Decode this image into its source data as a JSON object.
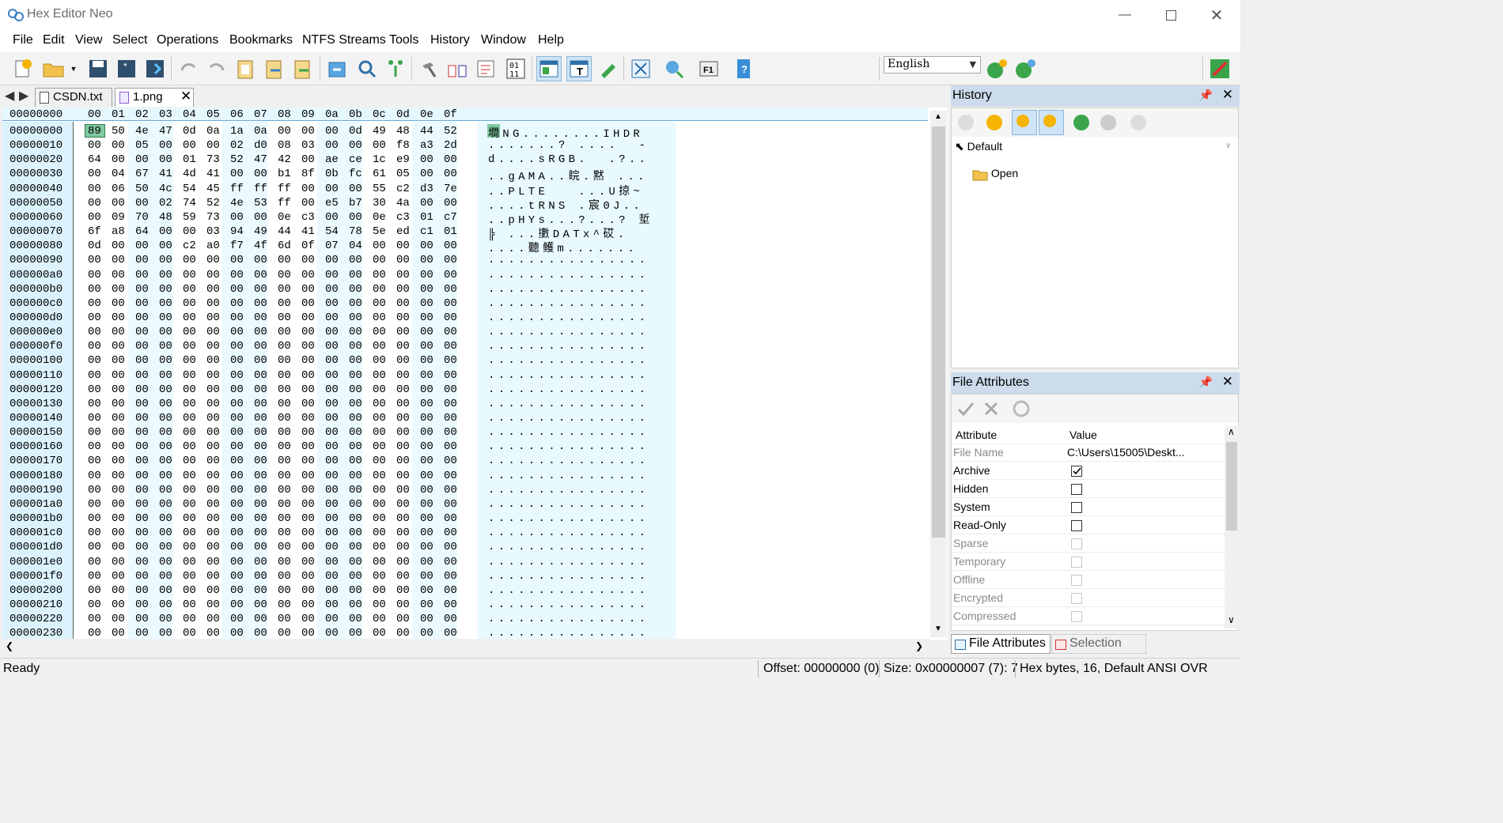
{
  "window": {
    "title": "Hex Editor Neo"
  },
  "menu": [
    "File",
    "Edit",
    "View",
    "Select",
    "Operations",
    "Bookmarks",
    "NTFS Streams",
    "Tools",
    "History",
    "Window",
    "Help"
  ],
  "toolbar": {
    "language": "English"
  },
  "tabs": [
    {
      "label": "CSDN.txt",
      "active": false
    },
    {
      "label": "1.png",
      "active": true
    }
  ],
  "hex": {
    "header_offset": "00000000",
    "columns": [
      "00",
      "01",
      "02",
      "03",
      "04",
      "05",
      "06",
      "07",
      "08",
      "09",
      "0a",
      "0b",
      "0c",
      "0d",
      "0e",
      "0f"
    ],
    "rows": [
      {
        "off": "00000000",
        "bytes": "89 50 4e 47 0d 0a 1a 0a 00 00 00 0d 49 48 44 52",
        "text": "墹NG........IHDR"
      },
      {
        "off": "00000010",
        "bytes": "00 00 05 00 00 00 02 d0 08 03 00 00 00 f8 a3 2d",
        "text": ".......? ....  -"
      },
      {
        "off": "00000020",
        "bytes": "64 00 00 00 01 73 52 47 42 00 ae ce 1c e9 00 00",
        "text": "d....sRGB.  .?.."
      },
      {
        "off": "00000030",
        "bytes": "00 04 67 41 4d 41 00 00 b1 8f 0b fc 61 05 00 00",
        "text": "..gAMA..睆.黙 ..."
      },
      {
        "off": "00000040",
        "bytes": "00 06 50 4c 54 45 ff ff ff 00 00 00 55 c2 d3 7e",
        "text": "..PLTE   ...U掠~"
      },
      {
        "off": "00000050",
        "bytes": "00 00 00 02 74 52 4e 53 ff 00 e5 b7 30 4a 00 00",
        "text": "....tRNS .宸0J.."
      },
      {
        "off": "00000060",
        "bytes": "00 09 70 48 59 73 00 00 0e c3 00 00 0e c3 01 c7",
        "text": "..pHYs...?...? 埑"
      },
      {
        "off": "00000070",
        "bytes": "6f a8 64 00 00 03 94 49 44 41 54 78 5e ed c1 01",
        "text": "╠ ...擻DATx^砹."
      },
      {
        "off": "00000080",
        "bytes": "0d 00 00 00 c2 a0 f7 4f 6d 0f 07 04 00 00 00 00",
        "text": "....聽鳠m......."
      },
      {
        "off": "00000090",
        "bytes": "00 00 00 00 00 00 00 00 00 00 00 00 00 00 00 00",
        "text": "................"
      },
      {
        "off": "000000a0",
        "bytes": "00 00 00 00 00 00 00 00 00 00 00 00 00 00 00 00",
        "text": "................"
      },
      {
        "off": "000000b0",
        "bytes": "00 00 00 00 00 00 00 00 00 00 00 00 00 00 00 00",
        "text": "................"
      },
      {
        "off": "000000c0",
        "bytes": "00 00 00 00 00 00 00 00 00 00 00 00 00 00 00 00",
        "text": "................"
      },
      {
        "off": "000000d0",
        "bytes": "00 00 00 00 00 00 00 00 00 00 00 00 00 00 00 00",
        "text": "................"
      },
      {
        "off": "000000e0",
        "bytes": "00 00 00 00 00 00 00 00 00 00 00 00 00 00 00 00",
        "text": "................"
      },
      {
        "off": "000000f0",
        "bytes": "00 00 00 00 00 00 00 00 00 00 00 00 00 00 00 00",
        "text": "................"
      },
      {
        "off": "00000100",
        "bytes": "00 00 00 00 00 00 00 00 00 00 00 00 00 00 00 00",
        "text": "................"
      },
      {
        "off": "00000110",
        "bytes": "00 00 00 00 00 00 00 00 00 00 00 00 00 00 00 00",
        "text": "................"
      },
      {
        "off": "00000120",
        "bytes": "00 00 00 00 00 00 00 00 00 00 00 00 00 00 00 00",
        "text": "................"
      },
      {
        "off": "00000130",
        "bytes": "00 00 00 00 00 00 00 00 00 00 00 00 00 00 00 00",
        "text": "................"
      },
      {
        "off": "00000140",
        "bytes": "00 00 00 00 00 00 00 00 00 00 00 00 00 00 00 00",
        "text": "................"
      },
      {
        "off": "00000150",
        "bytes": "00 00 00 00 00 00 00 00 00 00 00 00 00 00 00 00",
        "text": "................"
      },
      {
        "off": "00000160",
        "bytes": "00 00 00 00 00 00 00 00 00 00 00 00 00 00 00 00",
        "text": "................"
      },
      {
        "off": "00000170",
        "bytes": "00 00 00 00 00 00 00 00 00 00 00 00 00 00 00 00",
        "text": "................"
      },
      {
        "off": "00000180",
        "bytes": "00 00 00 00 00 00 00 00 00 00 00 00 00 00 00 00",
        "text": "................"
      },
      {
        "off": "00000190",
        "bytes": "00 00 00 00 00 00 00 00 00 00 00 00 00 00 00 00",
        "text": "................"
      },
      {
        "off": "000001a0",
        "bytes": "00 00 00 00 00 00 00 00 00 00 00 00 00 00 00 00",
        "text": "................"
      },
      {
        "off": "000001b0",
        "bytes": "00 00 00 00 00 00 00 00 00 00 00 00 00 00 00 00",
        "text": "................"
      },
      {
        "off": "000001c0",
        "bytes": "00 00 00 00 00 00 00 00 00 00 00 00 00 00 00 00",
        "text": "................"
      },
      {
        "off": "000001d0",
        "bytes": "00 00 00 00 00 00 00 00 00 00 00 00 00 00 00 00",
        "text": "................"
      },
      {
        "off": "000001e0",
        "bytes": "00 00 00 00 00 00 00 00 00 00 00 00 00 00 00 00",
        "text": "................"
      },
      {
        "off": "000001f0",
        "bytes": "00 00 00 00 00 00 00 00 00 00 00 00 00 00 00 00",
        "text": "................"
      },
      {
        "off": "00000200",
        "bytes": "00 00 00 00 00 00 00 00 00 00 00 00 00 00 00 00",
        "text": "................"
      },
      {
        "off": "00000210",
        "bytes": "00 00 00 00 00 00 00 00 00 00 00 00 00 00 00 00",
        "text": "................"
      },
      {
        "off": "00000220",
        "bytes": "00 00 00 00 00 00 00 00 00 00 00 00 00 00 00 00",
        "text": "................"
      },
      {
        "off": "00000230",
        "bytes": "00 00 00 00 00 00 00 00 00 00 00 00 00 00 00 00",
        "text": "................"
      }
    ]
  },
  "history": {
    "title": "History",
    "group": "Default",
    "items": [
      "Open"
    ]
  },
  "attributes": {
    "title": "File Attributes",
    "col_attr": "Attribute",
    "col_value": "Value",
    "file_name_label": "File Name",
    "file_name_value": "C:\\Users\\15005\\Deskt...",
    "flags": [
      {
        "name": "Archive",
        "checked": true,
        "enabled": true
      },
      {
        "name": "Hidden",
        "checked": false,
        "enabled": true
      },
      {
        "name": "System",
        "checked": false,
        "enabled": true
      },
      {
        "name": "Read-Only",
        "checked": false,
        "enabled": true
      },
      {
        "name": "Sparse",
        "checked": false,
        "enabled": false
      },
      {
        "name": "Temporary",
        "checked": false,
        "enabled": false
      },
      {
        "name": "Offline",
        "checked": false,
        "enabled": false
      },
      {
        "name": "Encrypted",
        "checked": false,
        "enabled": false
      },
      {
        "name": "Compressed",
        "checked": false,
        "enabled": false
      }
    ]
  },
  "bottom_tabs": [
    "File Attributes",
    "Selection"
  ],
  "status": {
    "state": "Ready",
    "offset": "Offset: 00000000 (0)",
    "size": "Size: 0x00000007 (7): 7",
    "mode": "Hex bytes, 16, Default ANSI",
    "ovr": "OVR"
  },
  "colors": {
    "accent": "#ccdcec",
    "offset_bg": "#dcf3fd",
    "cursor": "#7fc9a0"
  }
}
